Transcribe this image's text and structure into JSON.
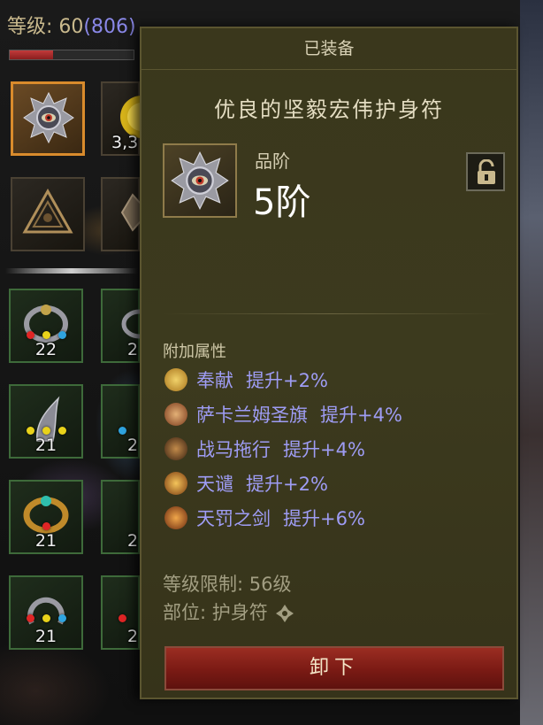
{
  "player": {
    "level_label": "等级: ",
    "level": "60",
    "paragon": "(806)",
    "hp_fraction": 0.35
  },
  "inventory": {
    "slots": [
      {
        "count": ""
      },
      {
        "count": "3,3"
      },
      {
        "count": ""
      },
      {
        "count": ""
      },
      {
        "count": "22"
      },
      {
        "count": "2"
      },
      {
        "count": "21"
      },
      {
        "count": "2"
      },
      {
        "count": "21"
      },
      {
        "count": "2"
      },
      {
        "count": "21"
      },
      {
        "count": "2"
      }
    ]
  },
  "tooltip": {
    "header": "已装备",
    "item_name": "优良的坚毅宏伟护身符",
    "tier_label": "品阶",
    "tier_value": "5阶",
    "attributes_heading": "附加属性",
    "attributes": [
      {
        "name": "奉献",
        "effect": "提升+2%",
        "icon": "offering-icon"
      },
      {
        "name": "萨卡兰姆圣旗",
        "effect": "提升+4%",
        "icon": "banner-icon"
      },
      {
        "name": "战马拖行",
        "effect": "提升+4%",
        "icon": "warhorse-icon"
      },
      {
        "name": "天谴",
        "effect": "提升+2%",
        "icon": "heaven-wrath-icon"
      },
      {
        "name": "天罚之剑",
        "effect": "提升+6%",
        "icon": "sword-icon"
      }
    ],
    "level_requirement": "等级限制: 56级",
    "slot_type": "部位: 护身符",
    "unequip_label": "卸下"
  },
  "colors": {
    "panel_bg": "#3a371c",
    "attribute_text": "#9e9cf4",
    "button_red": "#9b2d22",
    "selected_border": "#d98b2c"
  }
}
